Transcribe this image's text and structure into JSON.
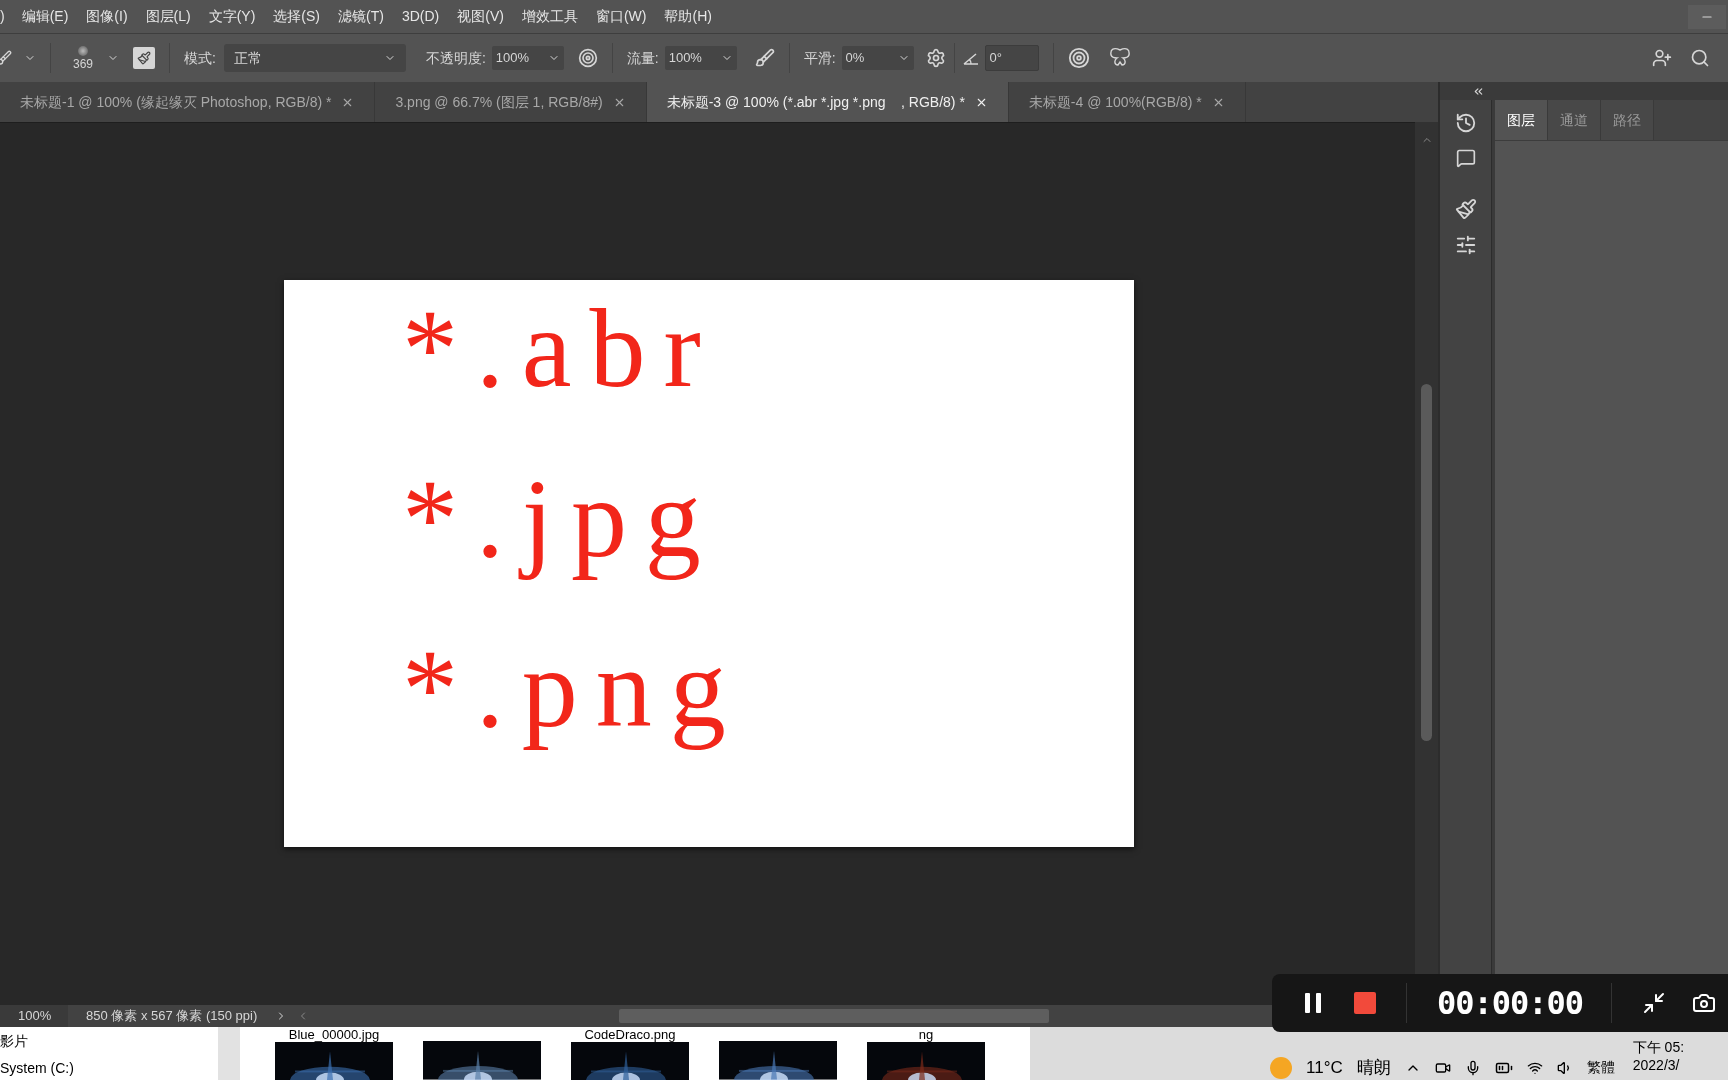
{
  "menu": [
    ")",
    "编辑(E)",
    "图像(I)",
    "图层(L)",
    "文字(Y)",
    "选择(S)",
    "滤镜(T)",
    "3D(D)",
    "视图(V)",
    "增效工具",
    "窗口(W)",
    "帮助(H)"
  ],
  "options": {
    "brush_size": "369",
    "mode_label": "模式:",
    "mode": "正常",
    "opacity_label": "不透明度:",
    "opacity": "100%",
    "flow_label": "流量:",
    "flow": "100%",
    "smoothing_label": "平滑:",
    "smoothing": "0%",
    "angle": "0°"
  },
  "tabs": [
    {
      "label": "未标题-1 @ 100% (缘起缘灭 Photoshop, RGB/8) *",
      "selected": false
    },
    {
      "label": "3.png @ 66.7% (图层 1, RGB/8#)",
      "selected": false
    },
    {
      "label": "未标题-3 @ 100% (*.abr *.jpg *.png    , RGB/8) *",
      "selected": true
    },
    {
      "label": "未标题-4 @ 100%(RGB/8) *",
      "selected": false
    }
  ],
  "canvas": {
    "lines": [
      "*.abr",
      "*.jpg",
      "*.png"
    ]
  },
  "panel": {
    "tabs": [
      {
        "label": "图层",
        "selected": true
      },
      {
        "label": "通道",
        "selected": false
      },
      {
        "label": "路径",
        "selected": false
      }
    ]
  },
  "status_bar": {
    "zoom": "100%",
    "info": "850 像素 x 567 像素 (150 ppi)"
  },
  "recorder": {
    "time": "00:00:00"
  },
  "explorer": {
    "nav": [
      "影片",
      "System (C:)"
    ],
    "files": [
      {
        "kind": "picture",
        "name": "Blue_00000.jpg"
      },
      {
        "kind": "picture"
      },
      {
        "kind": "picture",
        "name": "CodeDraco.png"
      },
      {
        "kind": "picture"
      },
      {
        "kind": "picture",
        "name": "ng"
      }
    ]
  },
  "taskbar": {
    "temperature": "11°C",
    "weather": "晴朗",
    "ime": "繁體",
    "time": "下午 05:",
    "date": "2022/3/"
  }
}
